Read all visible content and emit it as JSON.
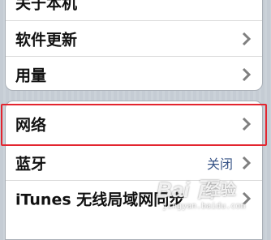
{
  "settings": {
    "rows": [
      {
        "label": "关于本机",
        "value": ""
      },
      {
        "label": "软件更新",
        "value": ""
      },
      {
        "label": "用量",
        "value": ""
      },
      {
        "label": "网络",
        "value": ""
      },
      {
        "label": "蓝牙",
        "value": "关闭"
      },
      {
        "label": "iTunes 无线局域网同步",
        "value": ""
      }
    ]
  },
  "watermark": {
    "logo": "Bai 百",
    "sub": "经验",
    "url": "jingyan.baidu.com"
  },
  "colors": {
    "highlight": "#e3252f",
    "value_text": "#385487",
    "background": "#c5ccd4"
  }
}
